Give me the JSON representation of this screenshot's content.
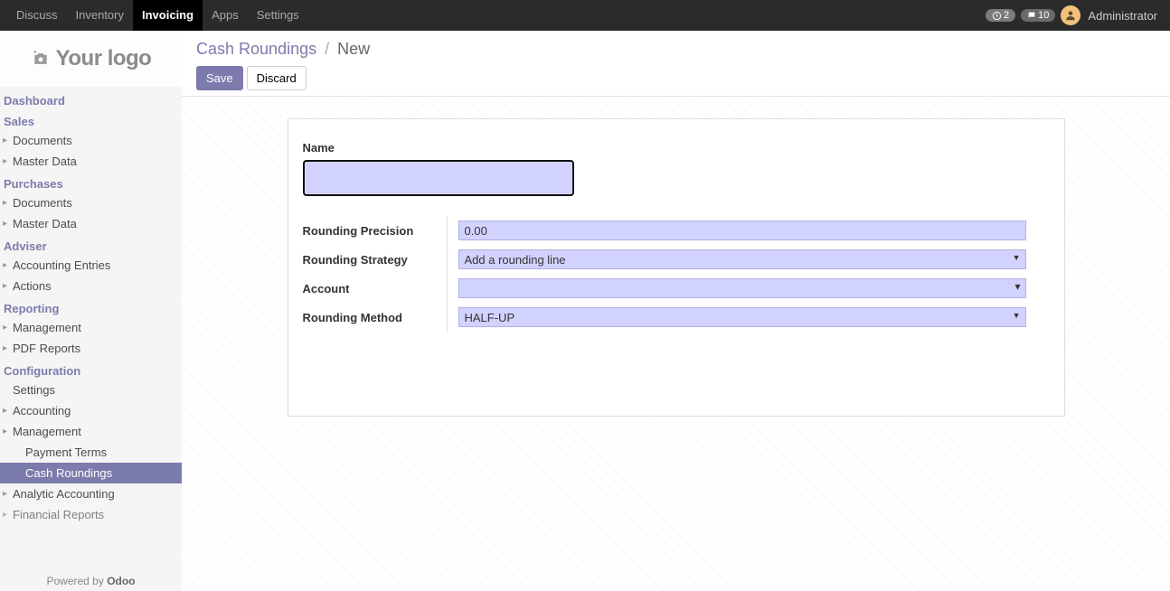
{
  "topnav": {
    "items": [
      "Discuss",
      "Inventory",
      "Invoicing",
      "Apps",
      "Settings"
    ],
    "active_index": 2,
    "badge_clock": "2",
    "badge_chat": "10",
    "username": "Administrator"
  },
  "logo_text": "Your logo",
  "sidebar": {
    "sections": [
      {
        "title": "Dashboard",
        "items": []
      },
      {
        "title": "Sales",
        "items": [
          "Documents",
          "Master Data"
        ]
      },
      {
        "title": "Purchases",
        "items": [
          "Documents",
          "Master Data"
        ]
      },
      {
        "title": "Adviser",
        "items": [
          "Accounting Entries",
          "Actions"
        ]
      },
      {
        "title": "Reporting",
        "items": [
          "Management",
          "PDF Reports"
        ]
      },
      {
        "title": "Configuration",
        "items_special": true
      }
    ],
    "config_items": {
      "settings": "Settings",
      "accounting": "Accounting",
      "management": "Management",
      "management_sub": [
        "Payment Terms",
        "Cash Roundings"
      ],
      "management_sub_active": 1,
      "analytic": "Analytic Accounting",
      "financial": "Financial Reports"
    }
  },
  "powered_by_prefix": "Powered by ",
  "powered_by_brand": "Odoo",
  "breadcrumb": {
    "link": "Cash Roundings",
    "current": "New"
  },
  "buttons": {
    "save": "Save",
    "discard": "Discard"
  },
  "form": {
    "name_label": "Name",
    "name_value": "",
    "rows": [
      {
        "label": "Rounding Precision",
        "type": "text",
        "value": "0.00"
      },
      {
        "label": "Rounding Strategy",
        "type": "select",
        "value": "Add a rounding line"
      },
      {
        "label": "Account",
        "type": "m2o",
        "value": ""
      },
      {
        "label": "Rounding Method",
        "type": "select",
        "value": "HALF-UP"
      }
    ]
  }
}
